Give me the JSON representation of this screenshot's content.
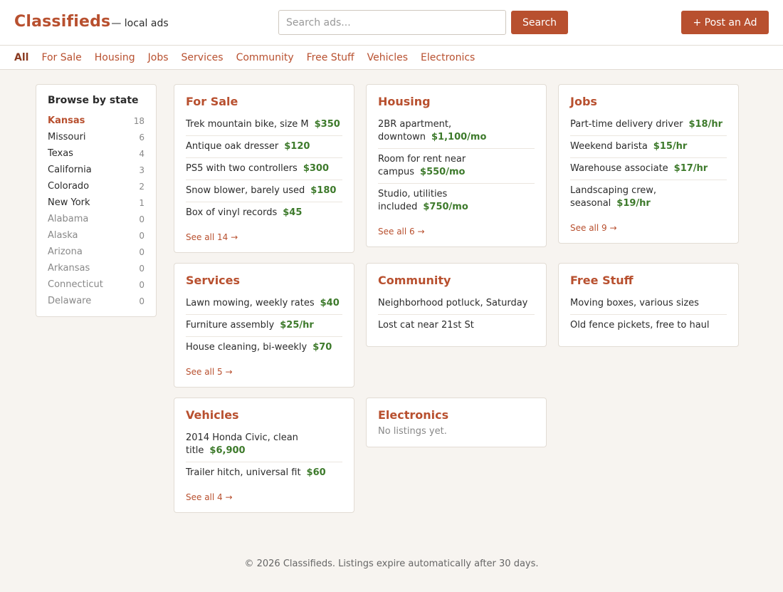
{
  "header": {
    "brand": "Classifieds",
    "tagline": "— local ads",
    "search_placeholder": "Search ads...",
    "search_label": "Search",
    "post_label": "+ Post an Ad"
  },
  "nav": [
    "All",
    "For Sale",
    "Housing",
    "Jobs",
    "Services",
    "Community",
    "Free Stuff",
    "Vehicles",
    "Electronics"
  ],
  "sidebar": {
    "title": "Browse by state",
    "states": [
      {
        "name": "Kansas",
        "count": "18"
      },
      {
        "name": "Missouri",
        "count": "6"
      },
      {
        "name": "Texas",
        "count": "4"
      },
      {
        "name": "California",
        "count": "3"
      },
      {
        "name": "Colorado",
        "count": "2"
      },
      {
        "name": "New York",
        "count": "1"
      },
      {
        "name": "Alabama",
        "count": "0"
      },
      {
        "name": "Alaska",
        "count": "0"
      },
      {
        "name": "Arizona",
        "count": "0"
      },
      {
        "name": "Arkansas",
        "count": "0"
      },
      {
        "name": "Connecticut",
        "count": "0"
      },
      {
        "name": "Delaware",
        "count": "0"
      }
    ]
  },
  "cards": {
    "for_sale": {
      "title": "For Sale",
      "items": [
        {
          "title": "Trek mountain bike, size M",
          "price": "$350"
        },
        {
          "title": "Antique oak dresser",
          "price": "$120"
        },
        {
          "title": "PS5 with two controllers",
          "price": "$300"
        },
        {
          "title": "Snow blower, barely used",
          "price": "$180"
        },
        {
          "title": "Box of vinyl records",
          "price": "$45"
        }
      ],
      "see_all": "See all 14 →"
    },
    "housing": {
      "title": "Housing",
      "items": [
        {
          "title": "2BR apartment, downtown",
          "price": "$1,100/mo"
        },
        {
          "title": "Room for rent near campus",
          "price": "$550/mo"
        },
        {
          "title": "Studio, utilities included",
          "price": "$750/mo"
        }
      ],
      "see_all": "See all 6 →"
    },
    "jobs": {
      "title": "Jobs",
      "items": [
        {
          "title": "Part-time delivery driver",
          "price": "$18/hr"
        },
        {
          "title": "Weekend barista",
          "price": "$15/hr"
        },
        {
          "title": "Warehouse associate",
          "price": "$17/hr"
        },
        {
          "title": "Landscaping crew, seasonal",
          "price": "$19/hr"
        }
      ],
      "see_all": "See all 9 →"
    },
    "services": {
      "title": "Services",
      "items": [
        {
          "title": "Lawn mowing, weekly rates",
          "price": "$40"
        },
        {
          "title": "Furniture assembly",
          "price": "$25/hr"
        },
        {
          "title": "House cleaning, bi-weekly",
          "price": "$70"
        }
      ],
      "see_all": "See all 5 →"
    },
    "community": {
      "title": "Community",
      "items": [
        {
          "title": "Neighborhood potluck, Saturday"
        },
        {
          "title": "Lost cat near 21st St"
        }
      ]
    },
    "free_stuff": {
      "title": "Free Stuff",
      "items": [
        {
          "title": "Moving boxes, various sizes"
        },
        {
          "title": "Old fence pickets, free to haul"
        }
      ]
    },
    "vehicles": {
      "title": "Vehicles",
      "items": [
        {
          "title": "2014 Honda Civic, clean title",
          "price": "$6,900"
        },
        {
          "title": "Trailer hitch, universal fit",
          "price": "$60"
        }
      ],
      "see_all": "See all 4 →"
    },
    "electronics": {
      "title": "Electronics",
      "empty_text": "No listings yet."
    }
  },
  "footer": "© 2026 Classifieds. Listings expire automatically after 30 days."
}
